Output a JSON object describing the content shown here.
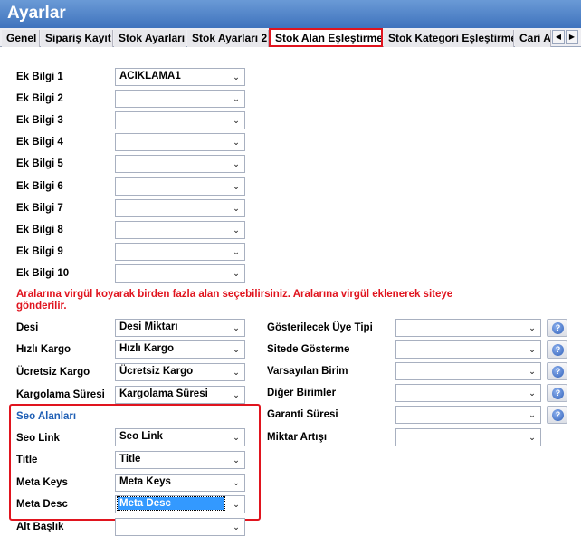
{
  "window": {
    "title": "Ayarlar"
  },
  "tabs": [
    {
      "label": "Genel"
    },
    {
      "label": "Sipariş Kayıt"
    },
    {
      "label": "Stok Ayarları"
    },
    {
      "label": "Stok Ayarları 2"
    },
    {
      "label": "Stok Alan Eşleştirme"
    },
    {
      "label": "Stok Kategori Eşleştirme"
    },
    {
      "label": "Cari Ay"
    }
  ],
  "tab_scroll": {
    "left": "◀",
    "right": "▶"
  },
  "ek_bilgi": [
    {
      "label": "Ek Bilgi 1",
      "value": "ACIKLAMA1"
    },
    {
      "label": "Ek Bilgi 2",
      "value": ""
    },
    {
      "label": "Ek Bilgi 3",
      "value": ""
    },
    {
      "label": "Ek Bilgi 4",
      "value": ""
    },
    {
      "label": "Ek Bilgi 5",
      "value": ""
    },
    {
      "label": "Ek Bilgi 6",
      "value": ""
    },
    {
      "label": "Ek Bilgi 7",
      "value": ""
    },
    {
      "label": "Ek Bilgi 8",
      "value": ""
    },
    {
      "label": "Ek Bilgi 9",
      "value": ""
    },
    {
      "label": "Ek Bilgi 10",
      "value": ""
    }
  ],
  "note": "Aralarına virgül koyarak birden fazla alan seçebilirsiniz. Aralarına virgül  eklenerek siteye gönderilir.",
  "left_fields": [
    {
      "label": "Desi",
      "value": "Desi Miktarı"
    },
    {
      "label": "Hızlı Kargo",
      "value": "Hızlı Kargo"
    },
    {
      "label": "Ücretsiz Kargo",
      "value": "Ücretsiz Kargo"
    },
    {
      "label": "Kargolama Süresi",
      "value": "Kargolama Süresi"
    }
  ],
  "seo": {
    "title": "Seo Alanları",
    "fields": [
      {
        "label": "Seo Link",
        "value": "Seo Link"
      },
      {
        "label": "Title",
        "value": "Title"
      },
      {
        "label": "Meta Keys",
        "value": "Meta Keys"
      },
      {
        "label": "Meta Desc",
        "value": "Meta Desc"
      }
    ]
  },
  "alt_baslik": {
    "label": "Alt Başlık",
    "value": ""
  },
  "right_fields": [
    {
      "label": "Gösterilecek Üye Tipi",
      "value": "",
      "help": "?"
    },
    {
      "label": "Sitede Gösterme",
      "value": "",
      "help": "?"
    },
    {
      "label": "Varsayılan Birim",
      "value": "",
      "help": "?"
    },
    {
      "label": "Diğer Birimler",
      "value": "",
      "help": "?"
    },
    {
      "label": "Garanti Süresi",
      "value": "",
      "help": "?"
    },
    {
      "label": "Miktar Artışı",
      "value": ""
    }
  ],
  "dropdown_glyph": "⌄",
  "colors": {
    "accent": "#e0141e",
    "title_bar": "#4a7fc6",
    "seo_title": "#1f5fb5",
    "selection": "#3399ff"
  }
}
